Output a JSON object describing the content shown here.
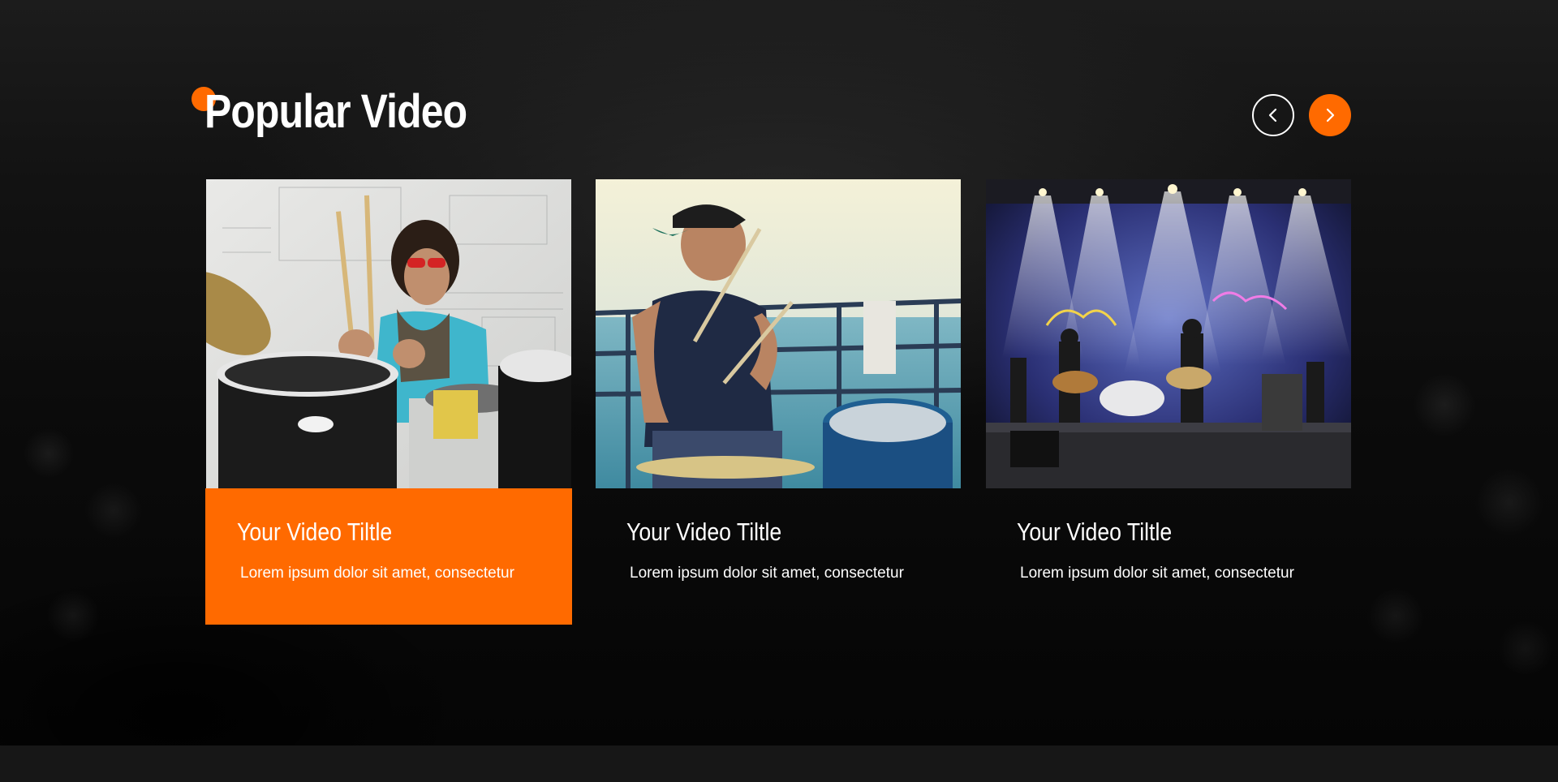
{
  "section": {
    "title": "Popular Video",
    "accent_color": "#ff6a00"
  },
  "slider_nav": {
    "prev_icon": "chevron-left-icon",
    "next_icon": "chevron-right-icon"
  },
  "videos": [
    {
      "title": "Your Video Tiltle",
      "description": "Lorem ipsum dolor sit amet, consectetur",
      "thumbnail": "drummer-with-sunglasses-photo",
      "active": true
    },
    {
      "title": "Your Video Tiltle",
      "description": "Lorem ipsum dolor sit amet, consectetur",
      "thumbnail": "drummer-by-the-sea-photo",
      "active": false
    },
    {
      "title": "Your Video Tiltle",
      "description": "Lorem ipsum dolor sit amet, consectetur",
      "thumbnail": "band-on-stage-photo",
      "active": false
    }
  ]
}
